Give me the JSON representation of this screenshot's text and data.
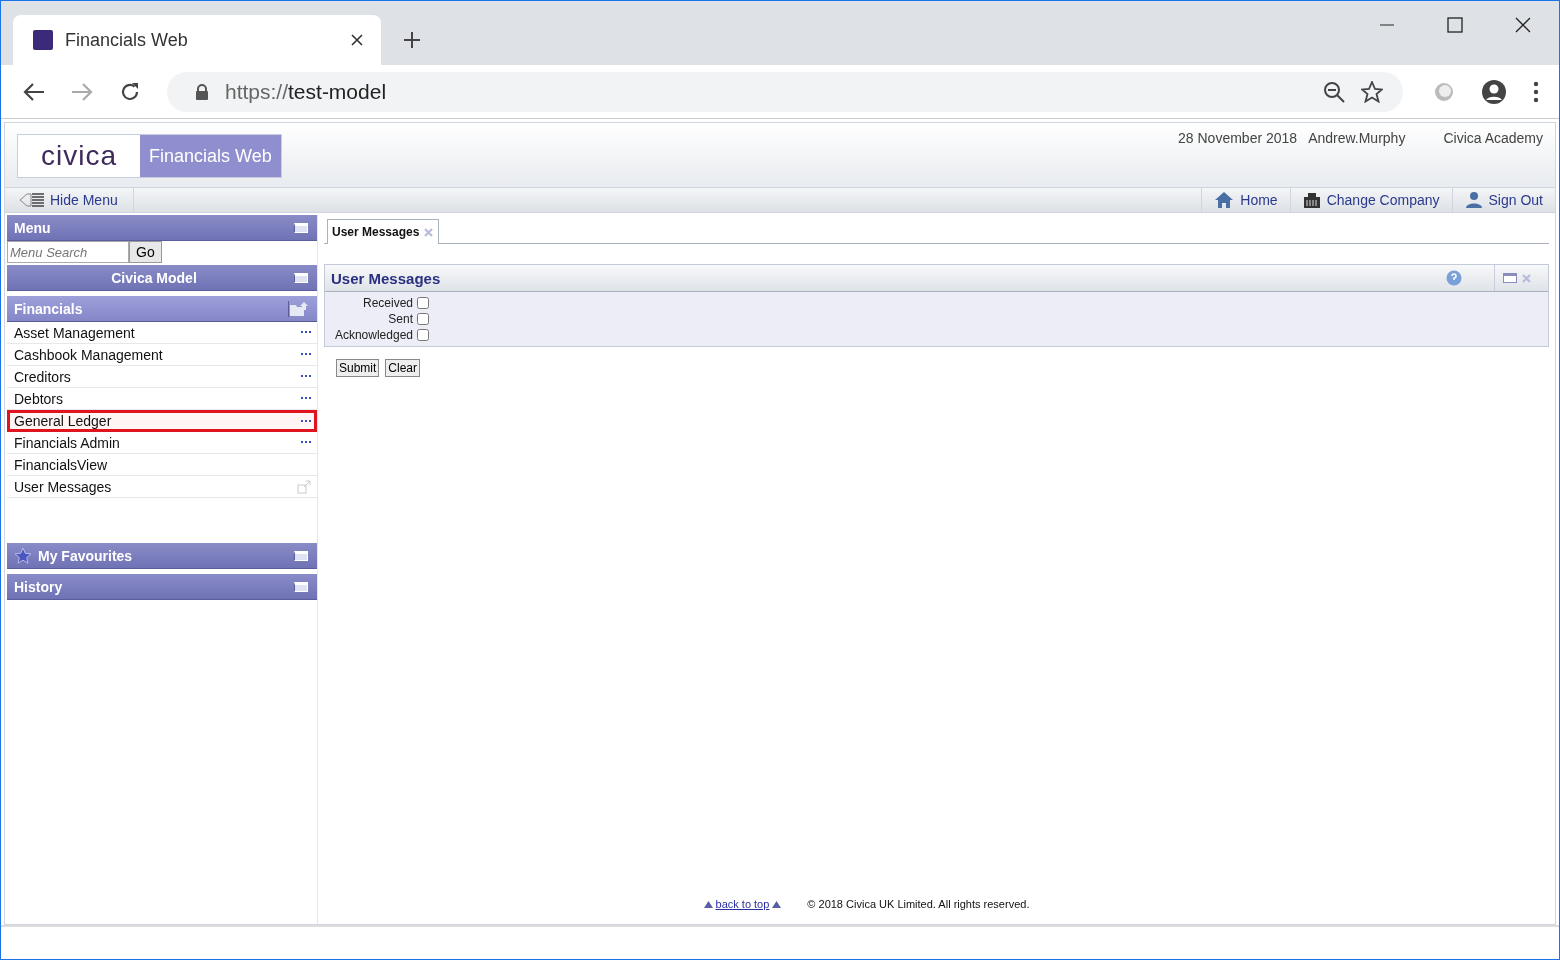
{
  "browser": {
    "tab_title": "Financials Web",
    "url_scheme": "https://",
    "url_host": "test-model"
  },
  "header": {
    "logo": "civica",
    "product": "Financials Web",
    "date": "28 November 2018",
    "user": "Andrew.Murphy",
    "company": "Civica Academy"
  },
  "toolbar": {
    "hide_menu": "Hide Menu",
    "links": [
      {
        "kind": "home",
        "label": "Home"
      },
      {
        "kind": "company",
        "label": "Change Company"
      },
      {
        "kind": "signout",
        "label": "Sign Out"
      }
    ]
  },
  "sidebar": {
    "menu_title": "Menu",
    "search_placeholder": "Menu Search",
    "go": "Go",
    "model": "Civica Model",
    "section": "Financials",
    "items": [
      {
        "label": "Asset Management",
        "kind": "more",
        "highlighted": false
      },
      {
        "label": "Cashbook Management",
        "kind": "more",
        "highlighted": false
      },
      {
        "label": "Creditors",
        "kind": "more",
        "highlighted": false
      },
      {
        "label": "Debtors",
        "kind": "more",
        "highlighted": false
      },
      {
        "label": "General Ledger",
        "kind": "more",
        "highlighted": true
      },
      {
        "label": "Financials Admin",
        "kind": "more",
        "highlighted": false
      },
      {
        "label": "FinancialsView",
        "kind": "plain",
        "highlighted": false
      },
      {
        "label": "User Messages",
        "kind": "external",
        "highlighted": false
      }
    ],
    "favourites": "My Favourites",
    "history": "History"
  },
  "content": {
    "tabs": [
      {
        "label": "User Messages",
        "selected": true
      }
    ],
    "panel_title": "User Messages",
    "filters": [
      {
        "label": "Received",
        "checked": false
      },
      {
        "label": "Sent",
        "checked": false
      },
      {
        "label": "Acknowledged",
        "checked": false
      }
    ],
    "buttons": [
      "Submit",
      "Clear"
    ]
  },
  "footer": {
    "back_to_top": "back to top",
    "copyright": "© 2018 Civica UK Limited. All rights reserved."
  }
}
